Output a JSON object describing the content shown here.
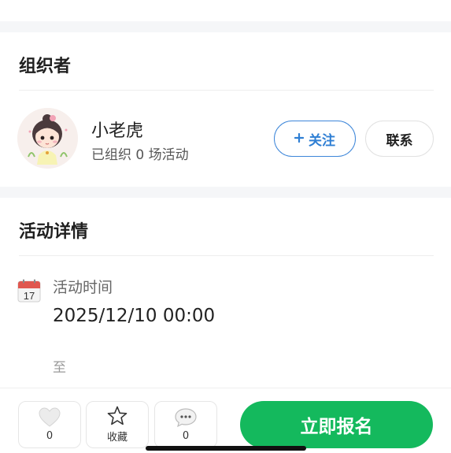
{
  "organizer": {
    "section_title": "组织者",
    "name": "小老虎",
    "stats": "已组织 0 场活动",
    "follow_label": "关注",
    "follow_icon": "plus-icon",
    "contact_label": "联系"
  },
  "details": {
    "section_title": "活动详情",
    "time_label": "活动时间",
    "start_time": "2025/12/10 00:00",
    "to_label": "至",
    "calendar_day": "17",
    "calendar_icon": "calendar-icon"
  },
  "bottom_bar": {
    "like_count": "0",
    "like_icon": "heart-icon",
    "favorite_label": "收藏",
    "favorite_icon": "star-icon",
    "comment_count": "0",
    "comment_icon": "comment-icon",
    "register_label": "立即报名"
  },
  "colors": {
    "accent_blue": "#2f7fd4",
    "register_green": "#14b95d",
    "section_gap": "#f5f6f8"
  }
}
